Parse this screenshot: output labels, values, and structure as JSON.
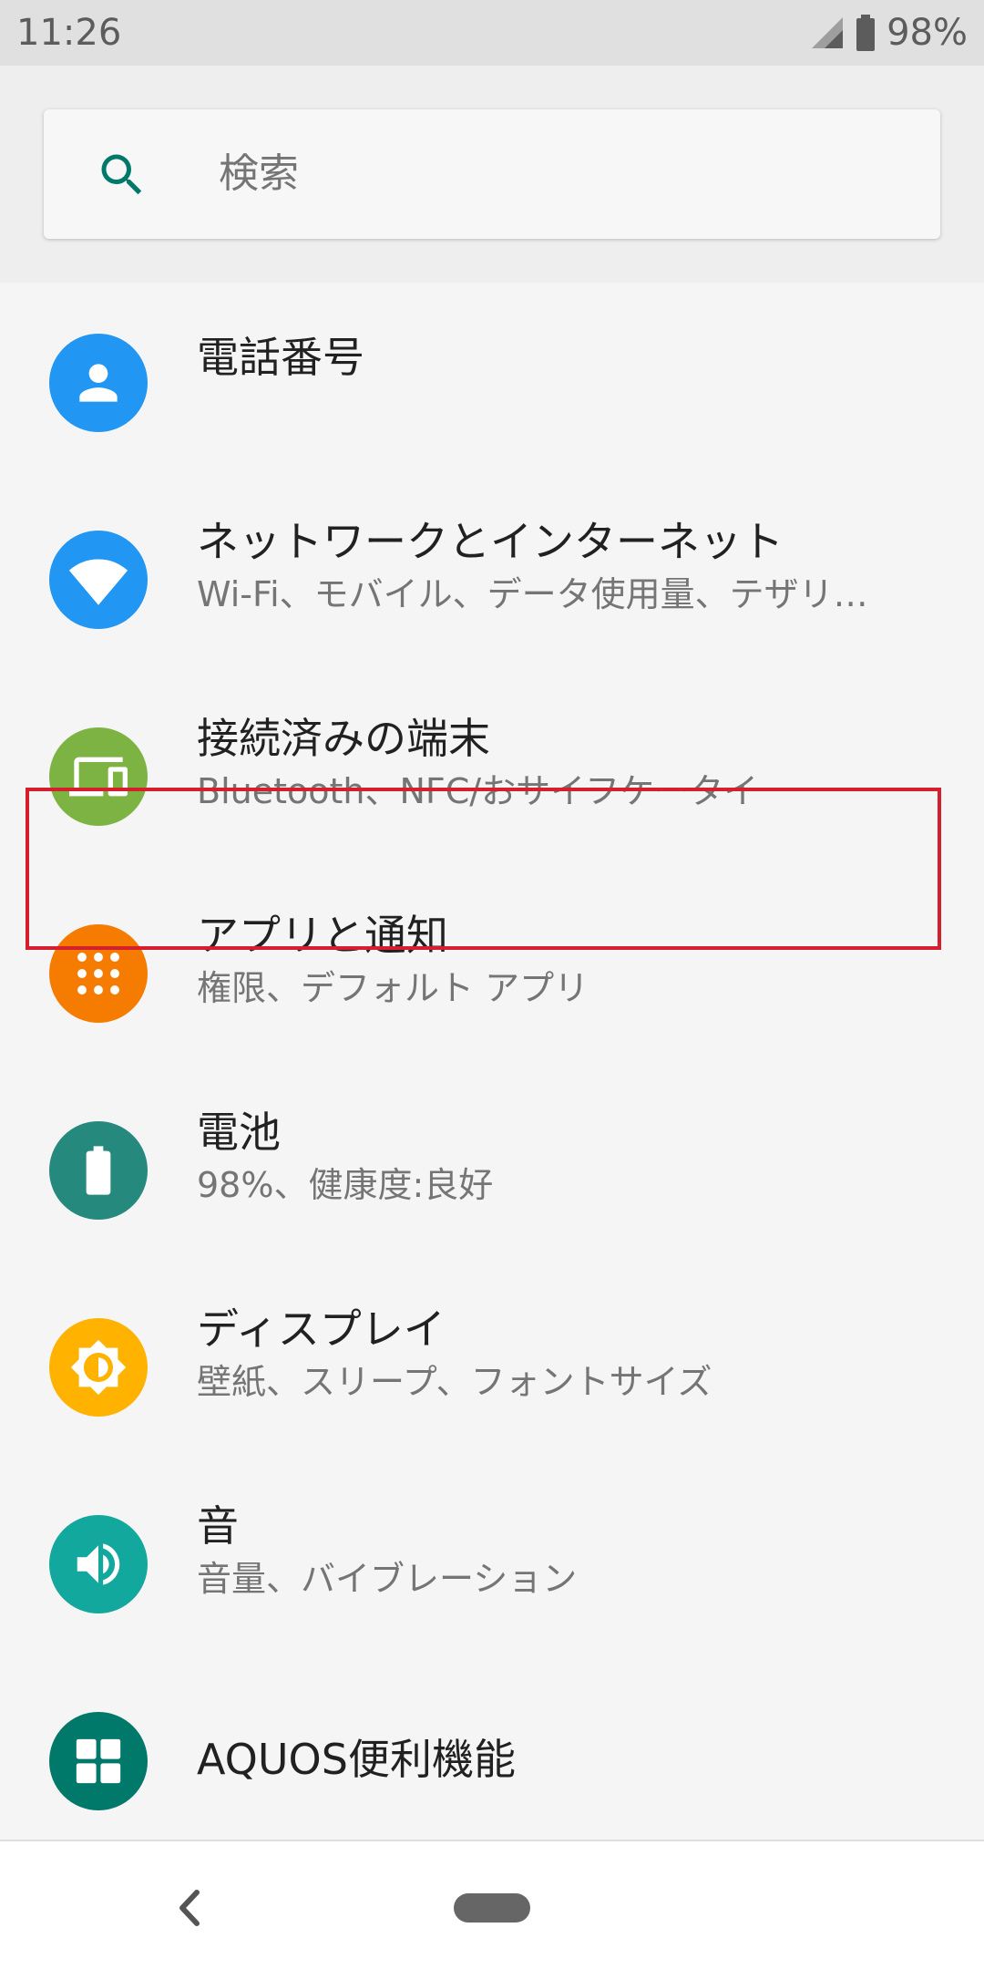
{
  "status_bar": {
    "time": "11:26",
    "battery": "98%"
  },
  "search": {
    "placeholder": "検索"
  },
  "settings": [
    {
      "title": "電話番号",
      "subtitle": "",
      "icon": "person-icon",
      "color": "#2196f3"
    },
    {
      "title": "ネットワークとインターネット",
      "subtitle": "Wi-Fi、モバイル、データ使用量、テザリ…",
      "icon": "wifi-icon",
      "color": "#2196f3"
    },
    {
      "title": "接続済みの端末",
      "subtitle": "Bluetooth、NFC/おサイフケータイ",
      "icon": "devices-icon",
      "color": "#7cb342"
    },
    {
      "title": "アプリと通知",
      "subtitle": "権限、デフォルト アプリ",
      "icon": "apps-icon",
      "color": "#f57c00"
    },
    {
      "title": "電池",
      "subtitle": "98%、健康度:良好",
      "icon": "battery-icon",
      "color": "#26897d"
    },
    {
      "title": "ディスプレイ",
      "subtitle": "壁紙、スリープ、フォントサイズ",
      "icon": "brightness-icon",
      "color": "#ffb300"
    },
    {
      "title": "音",
      "subtitle": "音量、バイブレーション",
      "icon": "volume-icon",
      "color": "#13a89e"
    },
    {
      "title": "AQUOS便利機能",
      "subtitle": "",
      "icon": "grid-icon",
      "color": "#00796b"
    }
  ],
  "highlight_color": "#d61f2c"
}
